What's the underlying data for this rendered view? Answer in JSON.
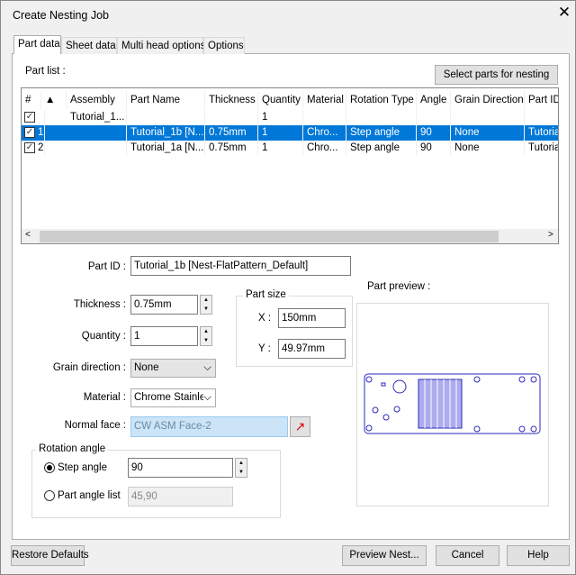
{
  "window": {
    "title": "Create Nesting Job"
  },
  "tabs": [
    {
      "label": "Part data"
    },
    {
      "label": "Sheet data"
    },
    {
      "label": "Multi head options"
    },
    {
      "label": "Options"
    }
  ],
  "part_list": {
    "label": "Part list :",
    "select_button": "Select parts for nesting",
    "columns": [
      "#",
      "▲",
      "Assembly",
      "Part Name",
      "Thickness",
      "Quantity",
      "Material",
      "Rotation Type",
      "Angle",
      "Grain Direction",
      "Part ID"
    ],
    "rows": [
      {
        "checked": true,
        "num": "",
        "assembly": "Tutorial_1...",
        "part_name": "",
        "thickness": "",
        "quantity": "1",
        "material": "",
        "rotation_type": "",
        "angle": "",
        "grain": "",
        "part_id": "",
        "selected": false
      },
      {
        "checked": true,
        "num": "1",
        "assembly": "",
        "part_name": "Tutorial_1b [N...",
        "thickness": "0.75mm",
        "quantity": "1",
        "material": "Chro...",
        "rotation_type": "Step angle",
        "angle": "90",
        "grain": "None",
        "part_id": "Tutorial",
        "selected": true
      },
      {
        "checked": true,
        "num": "2",
        "assembly": "",
        "part_name": "Tutorial_1a [N...",
        "thickness": "0.75mm",
        "quantity": "1",
        "material": "Chro...",
        "rotation_type": "Step angle",
        "angle": "90",
        "grain": "None",
        "part_id": "Tutorial",
        "selected": false
      }
    ]
  },
  "form": {
    "part_id": {
      "label": "Part ID :",
      "value": "Tutorial_1b [Nest-FlatPattern_Default]"
    },
    "thickness": {
      "label": "Thickness :",
      "value": "0.75mm"
    },
    "quantity": {
      "label": "Quantity :",
      "value": "1"
    },
    "grain_direction": {
      "label": "Grain direction :",
      "value": "None"
    },
    "material": {
      "label": "Material :",
      "value": "Chrome Stainles"
    },
    "normal_face": {
      "label": "Normal face :",
      "value": "CW ASM Face-2"
    }
  },
  "part_size": {
    "label": "Part size",
    "x_label": "X :",
    "x_value": "150mm",
    "y_label": "Y :",
    "y_value": "49.97mm"
  },
  "part_preview": {
    "label": "Part preview :",
    "line_color": "#2a2ab8"
  },
  "rotation": {
    "label": "Rotation angle",
    "step_label": "Step angle",
    "step_value": "90",
    "list_label": "Part angle list",
    "list_value": "45,90",
    "selected": "step"
  },
  "buttons": {
    "restore": "Restore Defaults",
    "preview": "Preview Nest...",
    "cancel": "Cancel",
    "help": "Help"
  },
  "colors": {
    "selection": "#0078d7"
  }
}
